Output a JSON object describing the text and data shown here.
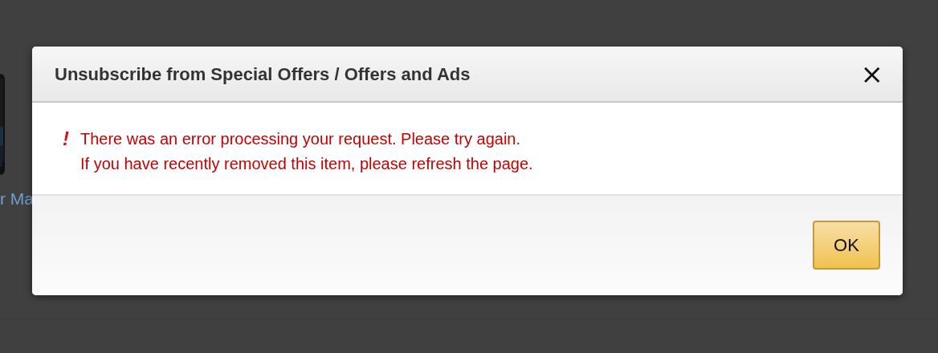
{
  "background": {
    "product_caption": "r Ma"
  },
  "dialog": {
    "title": "Unsubscribe from Special Offers / Offers and Ads",
    "close": "×",
    "error": {
      "icon": "!",
      "lines": [
        "There was an error processing your request. Please try again.",
        "If you have recently removed this item, please refresh the page."
      ]
    },
    "buttons": [
      "OK"
    ]
  }
}
